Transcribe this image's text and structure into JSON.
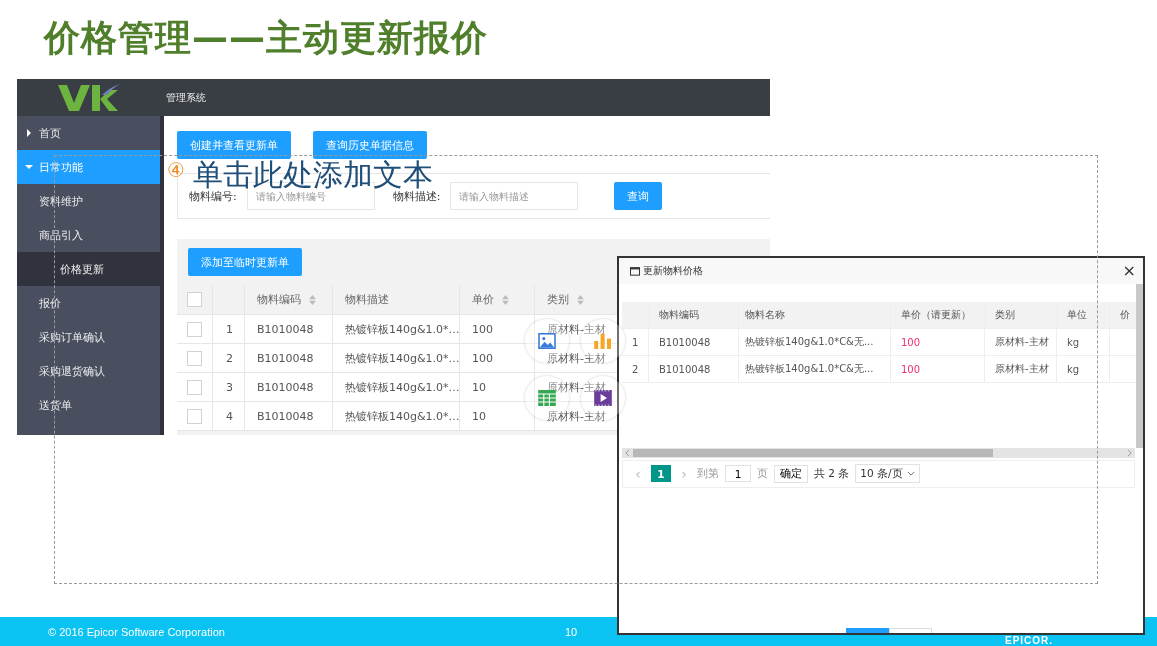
{
  "slide": {
    "title": "价格管理——主动更新报价"
  },
  "app": {
    "header_title": "管理系统",
    "sidebar": [
      {
        "label": "首页",
        "expanded": false,
        "selected": false
      },
      {
        "label": "日常功能",
        "expanded": true,
        "selected": true,
        "children": [
          {
            "label": "资料维护",
            "selected": false
          },
          {
            "label": "商品引入",
            "selected": false,
            "children": [
              {
                "label": "价格更新",
                "selected": true
              }
            ]
          },
          {
            "label": "报价",
            "selected": false
          },
          {
            "label": "采购订单确认",
            "selected": false
          },
          {
            "label": "采购退货确认",
            "selected": false
          },
          {
            "label": "送货单",
            "selected": false
          }
        ]
      }
    ],
    "actions": [
      "创建并查看更新单",
      "查询历史单据信息"
    ],
    "search": {
      "fields": [
        {
          "label": "物料编号:",
          "placeholder": "请输入物料编号"
        },
        {
          "label": "物料描述:",
          "placeholder": "请输入物料描述"
        }
      ],
      "button": "查询"
    },
    "add_button": "添加至临时更新单",
    "table": {
      "all_checked": false,
      "columns": [
        {
          "label": "物料编码",
          "sortable": true
        },
        {
          "label": "物料描述",
          "sortable": false
        },
        {
          "label": "单价",
          "sortable": true
        },
        {
          "label": "类别",
          "sortable": true
        }
      ],
      "rows": [
        {
          "checked": false,
          "index": "1",
          "code": "B1010048",
          "description": "热镀锌板140g&1.0*…",
          "price": "100",
          "category": "原材料-主材"
        },
        {
          "checked": false,
          "index": "2",
          "code": "B1010048",
          "description": "热镀锌板140g&1.0*…",
          "price": "100",
          "category": "原材料-主材"
        },
        {
          "checked": false,
          "index": "3",
          "code": "B1010048",
          "description": "热镀锌板140g&1.0*…",
          "price": "10",
          "category": "原材料-主材"
        },
        {
          "checked": false,
          "index": "4",
          "code": "B1010048",
          "description": "热镀锌板140g&1.0*…",
          "price": "10",
          "category": "原材料-主材"
        }
      ]
    }
  },
  "placeholder": {
    "number": "④",
    "text": "单击此处添加文本"
  },
  "dialog": {
    "title": "更新物料价格",
    "close": "×",
    "columns": [
      "物料编码",
      "物料名称",
      "单价（请更新）",
      "类别",
      "单位",
      "价"
    ],
    "rows": [
      {
        "index": "1",
        "code": "B1010048",
        "name": "热镀锌板140g&1.0*C&无...",
        "price": "100",
        "category": "原材料-主材",
        "unit": "kg"
      },
      {
        "index": "2",
        "code": "B1010048",
        "name": "热镀锌板140g&1.0*C&无...",
        "price": "100",
        "category": "原材料-主材",
        "unit": "kg"
      }
    ],
    "pagination": {
      "prev": "‹",
      "current": "1",
      "next": "›",
      "goto_label": "到第",
      "page_input": "1",
      "page_suffix": "页",
      "confirm": "确定",
      "total": "共 2 条",
      "page_size": "10 条/页"
    }
  },
  "footer": {
    "copyright": "© 2016 Epicor Software Corporation",
    "page_number": "10",
    "logo": "EPICOR."
  }
}
